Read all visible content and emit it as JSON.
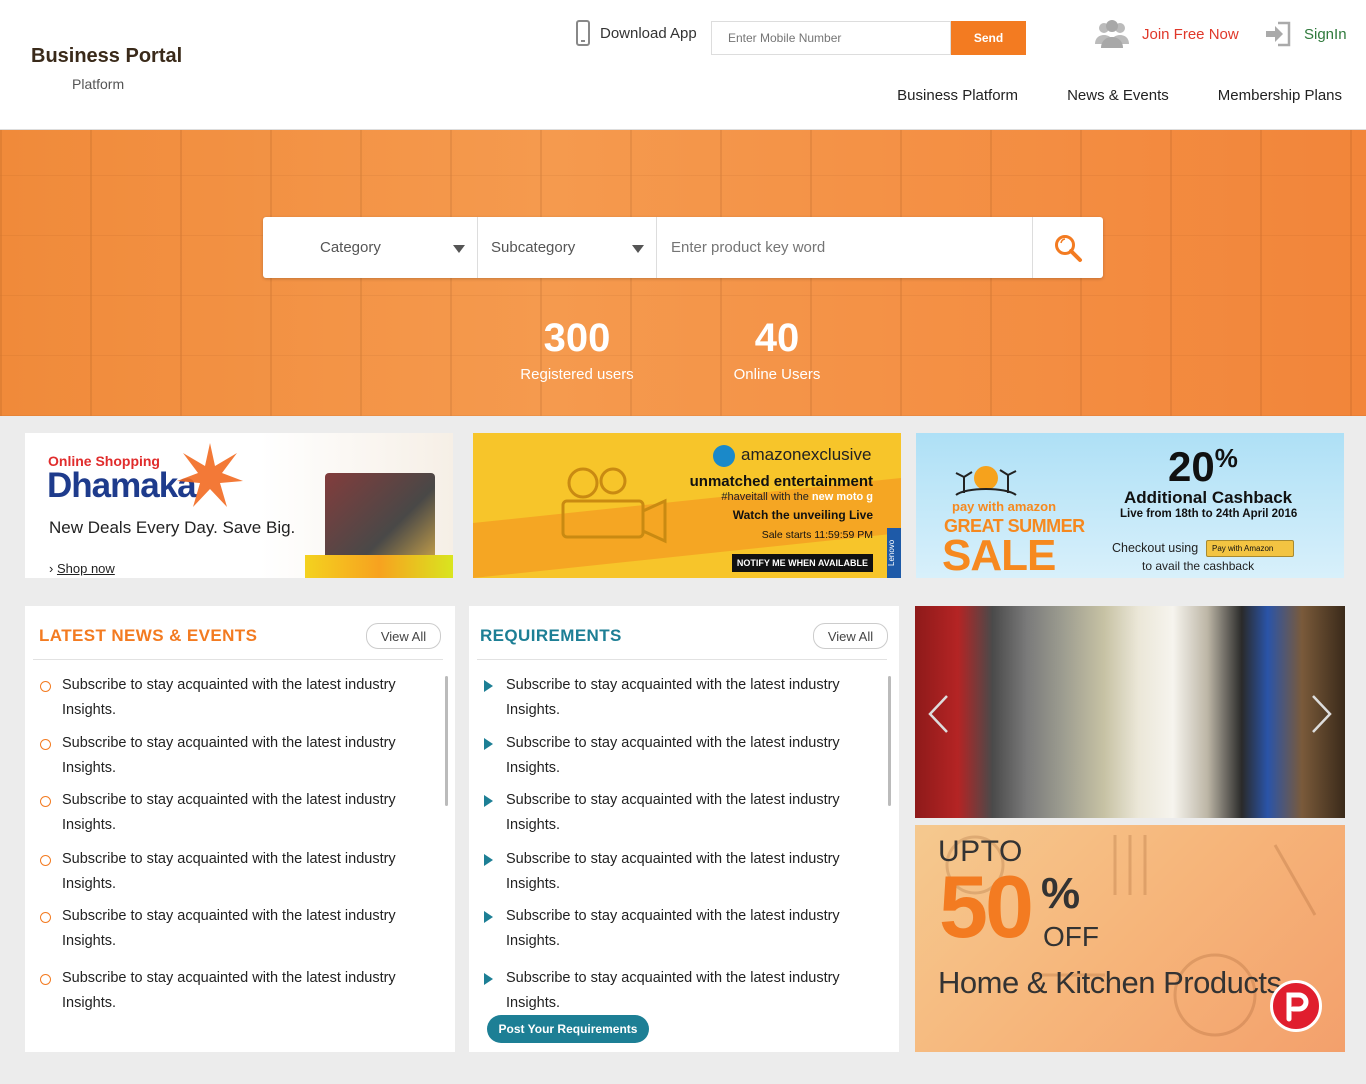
{
  "brand": {
    "title": "Business Portal",
    "subtitle": "Platform"
  },
  "header": {
    "download_app": "Download App",
    "mobile_placeholder": "Enter Mobile Number",
    "send_label": "Send",
    "join_label": "Join Free Now",
    "signin_label": "SignIn"
  },
  "nav": {
    "items": [
      "Business Platform",
      "News & Events",
      "Membership Plans"
    ]
  },
  "search": {
    "category": "Category",
    "subcategory": "Subcategory",
    "keyword_placeholder": "Enter product key word"
  },
  "stats": [
    {
      "value": "300",
      "label": "Registered users"
    },
    {
      "value": "40",
      "label": "Online Users"
    }
  ],
  "banners": {
    "b1": {
      "line1": "Online Shopping",
      "line2": "Dhamaka",
      "tagline": "New Deals Every Day. Save Big.",
      "cta": "Shop now"
    },
    "b2": {
      "brand": "amazonexclusive",
      "headline": "unmatched entertainment",
      "hashtag": "#haveitall with the",
      "product": "new moto g",
      "line": "Watch the unveiling Live",
      "sale": "Sale starts 11:59:59 PM",
      "cta": "NOTIFY ME WHEN AVAILABLE",
      "side": "Lenovo"
    },
    "b3": {
      "pay": "pay with amazon",
      "line1": "GREAT SUMMER",
      "line2": "SALE",
      "percent": "20",
      "pct_sign": "%",
      "cashback": "Additional Cashback",
      "dates": "Live from 18th to 24th April 2016",
      "checkout": "Checkout using",
      "btn": "Pay with Amazon",
      "avail": "to avail the cashback"
    }
  },
  "news": {
    "title": "LATEST NEWS & EVENTS",
    "view_all": "View All",
    "items": [
      "Subscribe to stay acquainted with the latest industry Insights.",
      "Subscribe to stay acquainted with the latest industry Insights.",
      "Subscribe to stay acquainted with the latest industry Insights.",
      "Subscribe to stay acquainted with the latest industry Insights.",
      "Subscribe to stay acquainted with the latest industry Insights.",
      "Subscribe to stay acquainted with the latest industry Insights."
    ]
  },
  "requirements": {
    "title": "REQUIREMENTS",
    "view_all": "View All",
    "post_label": "Post Your Requirements",
    "items": [
      "Subscribe to stay acquainted with the latest industry Insights.",
      "Subscribe to stay acquainted with the latest industry Insights.",
      "Subscribe to stay acquainted with the latest industry Insights.",
      "Subscribe to stay acquainted with the latest industry Insights.",
      "Subscribe to stay acquainted with the latest industry Insights.",
      "Subscribe to stay acquainted with the latest industry Insights."
    ]
  },
  "promo": {
    "upto": "UPTO",
    "value": "50",
    "pct": "%",
    "off": "OFF",
    "label": "Home & Kitchen Products"
  },
  "colors": {
    "accent": "#f37b21",
    "teal": "#1d7f95",
    "join": "#e0382a",
    "signin": "#2f7a3c"
  }
}
